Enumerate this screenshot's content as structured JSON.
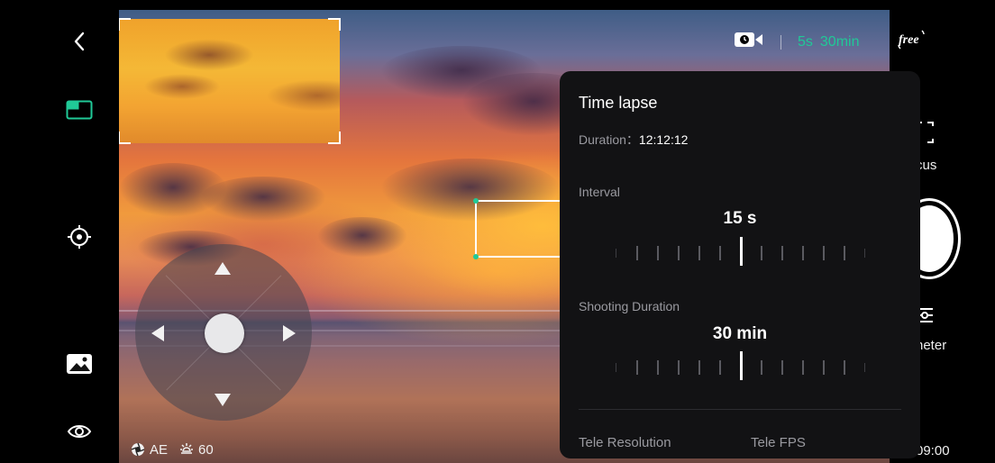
{
  "viewfinder": {
    "exposure_mode": "AE",
    "exposure_value": "60",
    "icons": {
      "mode_icon": "aperture-icon",
      "brightness_icon": "sun-icon"
    }
  },
  "left_rail": {
    "items": [
      {
        "name": "back",
        "icon": "chevron-left-icon"
      },
      {
        "name": "picture-in-picture",
        "icon": "pip-icon"
      },
      {
        "name": "target",
        "icon": "crosshair-icon"
      },
      {
        "name": "gallery",
        "icon": "image-icon"
      },
      {
        "name": "visibility",
        "icon": "eye-icon"
      }
    ],
    "accent": "#20c997"
  },
  "top_status": {
    "mode_icon": "video-timer-icon",
    "interval": "5s",
    "duration": "30min",
    "logo": "free"
  },
  "right_rail": {
    "focus_label": "cus",
    "meter_label": "neter",
    "time": "09:00"
  },
  "panel": {
    "title": "Time lapse",
    "duration_label": "Duration：",
    "duration_value": "12:12:12",
    "interval_label": "Interval",
    "interval_value": "15 s",
    "shooting_label": "Shooting Duration",
    "shooting_value": "30 min",
    "tele_resolution_label": "Tele Resolution",
    "tele_fps_label": "Tele FPS"
  },
  "colors": {
    "accent": "#20c997",
    "panel_bg": "#121214",
    "muted_text": "#9a9aa0"
  }
}
